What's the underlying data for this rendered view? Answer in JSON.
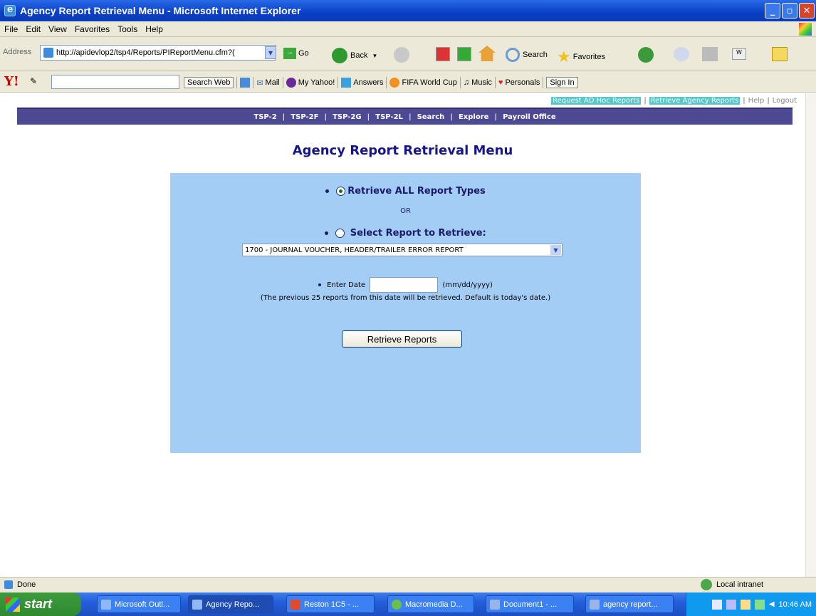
{
  "window": {
    "title": "Agency Report Retrieval Menu - Microsoft Internet Explorer"
  },
  "menubar": [
    "File",
    "Edit",
    "View",
    "Favorites",
    "Tools",
    "Help"
  ],
  "address": {
    "label": "Address",
    "url": "http://apidevlop2/tsp4/Reports/PIReportMenu.cfm?(",
    "go": "Go"
  },
  "toolbar": {
    "back": "Back",
    "search": "Search",
    "favorites": "Favorites"
  },
  "yahoo": {
    "search_web": "Search Web",
    "mail": "Mail",
    "my_yahoo": "My Yahoo!",
    "answers": "Answers",
    "fifa": "FIFA World Cup",
    "music": "Music",
    "personals": "Personals",
    "sign_in": "Sign In"
  },
  "top_links": {
    "adhoc": "Request AD Hoc Reports",
    "retrieve": "Retrieve Agency Reports",
    "help": "Help",
    "logout": "Logout"
  },
  "nav": [
    "TSP-2",
    "TSP-2F",
    "TSP-2G",
    "TSP-2L",
    "Search",
    "Explore",
    "Payroll Office"
  ],
  "page": {
    "heading": "Agency Report Retrieval Menu",
    "option_all": "Retrieve ALL Report Types",
    "or": "OR",
    "option_select": "Select Report to Retrieve:",
    "selected_report": "1700 - JOURNAL VOUCHER, HEADER/TRAILER ERROR REPORT",
    "enter_date": "Enter Date",
    "date_format": "(mm/dd/yyyy)",
    "date_value": "",
    "note": "(The previous 25 reports from this date will be retrieved. Default is today's date.)",
    "retrieve_button": "Retrieve Reports"
  },
  "status": {
    "text": "Done",
    "zone": "Local intranet"
  },
  "taskbar": {
    "start": "start",
    "tasks": [
      "Microsoft Outl...",
      "Agency Repo...",
      "Reston 1C5 - ...",
      "Macromedia D...",
      "Document1 - ...",
      "agency report..."
    ],
    "clock": "10:46 AM"
  },
  "colors": {
    "nav_bg": "#4c4a92",
    "panel_bg": "#a4cdf6",
    "heading": "#16168a",
    "highlight": "#5ac6c6"
  }
}
